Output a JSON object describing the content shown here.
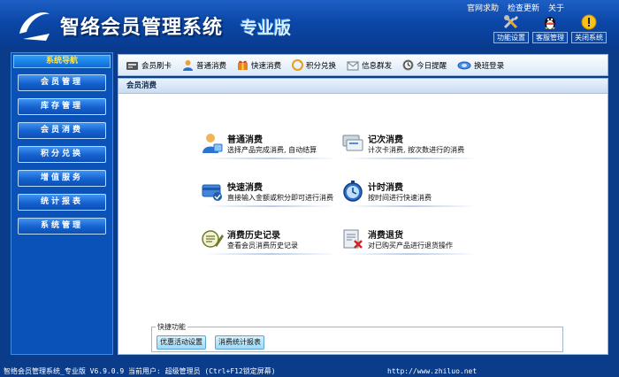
{
  "header": {
    "title": "智络会员管理系统",
    "edition": "专业版",
    "top_links": [
      "官网求助",
      "检查更新",
      "关于"
    ],
    "buttons": [
      {
        "label": "功能设置",
        "icon": "tools-icon"
      },
      {
        "label": "客服管理",
        "icon": "qq-penguin-icon"
      },
      {
        "label": "关闭系统",
        "icon": "warning-icon"
      }
    ]
  },
  "sidebar": {
    "title": "系统导航",
    "items": [
      "会员管理",
      "库存管理",
      "会员消费",
      "积分兑换",
      "增值服务",
      "统计报表",
      "系统管理"
    ]
  },
  "toolbar": {
    "items": [
      {
        "label": "会员刷卡",
        "icon": "card-reader-icon"
      },
      {
        "label": "普通消费",
        "icon": "person-icon"
      },
      {
        "label": "快速消费",
        "icon": "gift-box-icon"
      },
      {
        "label": "积分兑换",
        "icon": "refresh-coin-icon"
      },
      {
        "label": "信息群发",
        "icon": "envelope-icon"
      },
      {
        "label": "今日提醒",
        "icon": "clock-icon"
      },
      {
        "label": "换班登录",
        "icon": "rotate-icon"
      }
    ]
  },
  "content": {
    "title": "会员消费",
    "options": [
      {
        "title": "普通消费",
        "desc": "选择产品完成消费, 自动结算",
        "icon": "person-shopping-icon"
      },
      {
        "title": "记次消费",
        "desc": "计次卡消费, 按次数进行的消费",
        "icon": "card-stack-icon"
      },
      {
        "title": "快速消费",
        "desc": "直接输入金额或积分即可进行消费",
        "icon": "card-edit-icon"
      },
      {
        "title": "计时消费",
        "desc": "按时间进行快速消费",
        "icon": "stopwatch-icon"
      },
      {
        "title": "消费历史记录",
        "desc": "查看会员消费历史记录",
        "icon": "history-stamp-icon"
      },
      {
        "title": "消费退货",
        "desc": "对已购买产品进行退货操作",
        "icon": "return-doc-icon"
      }
    ],
    "quick": {
      "legend": "快捷功能",
      "buttons": [
        "优惠活动设置",
        "消费统计报表"
      ]
    }
  },
  "status": {
    "left": "智络会员管理系统_专业版 V6.9.0.9 当前用户: 超级管理员 (Ctrl+F12锁定屏幕)",
    "right": "http://www.zhiluo.net"
  },
  "colors": {
    "frame": "#0a3c8a",
    "header": "#0b47a8",
    "menu": "#1561cf",
    "accent": "#ffe24a"
  }
}
